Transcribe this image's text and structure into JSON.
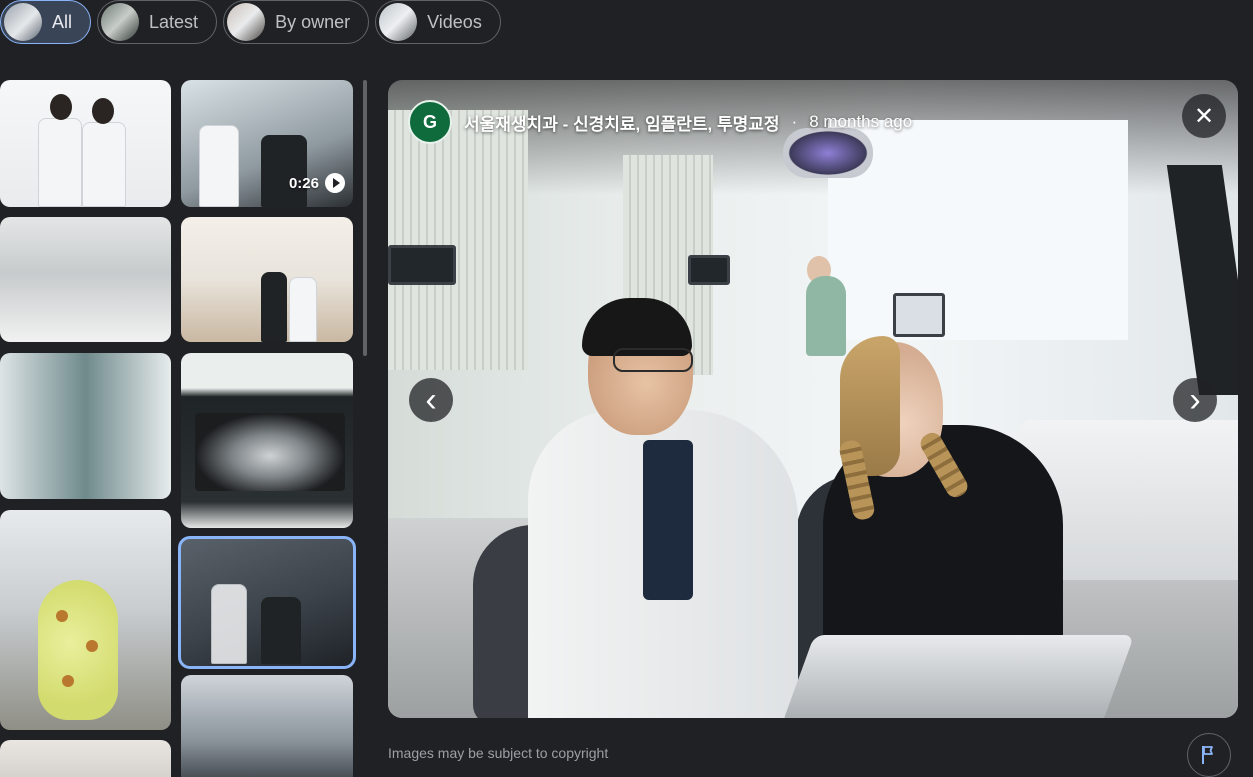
{
  "filters": [
    {
      "label": "All",
      "active": true
    },
    {
      "label": "Latest",
      "active": false
    },
    {
      "label": "By owner",
      "active": false
    },
    {
      "label": "Videos",
      "active": false
    }
  ],
  "thumbnails": {
    "video_duration": "0:26",
    "selected_index": 7
  },
  "viewer": {
    "logo_text": "G",
    "title": "서울재생치과 - 신경치료, 임플란트, 투명교정",
    "separator": "·",
    "time": "8 months ago",
    "close_symbol": "✕",
    "prev_symbol": "‹",
    "next_symbol": "›"
  },
  "footer": {
    "copyright": "Images may be subject to copyright"
  },
  "colors": {
    "background": "#202124",
    "accent": "#8ab4f8",
    "active_chip": "#394457",
    "logo_green": "#0f6b3c"
  },
  "icons": [
    "close-icon",
    "chevron-left-icon",
    "chevron-right-icon",
    "flag-icon",
    "play-icon"
  ]
}
